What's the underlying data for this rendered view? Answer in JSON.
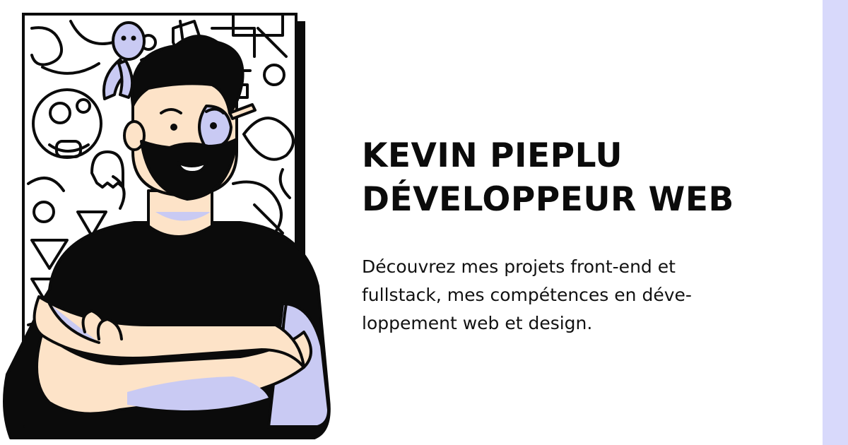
{
  "card": {
    "title_lines": [
      "KEVIN PIEPLU",
      "DÉVELOPPEUR WEB"
    ],
    "description_lines": [
      "Découvrez mes projets front-end et",
      "fullstack, mes compétences en déve-",
      "loppement web et design."
    ]
  },
  "colors": {
    "background": "#ffffff",
    "accent_lavender": "#d8d9fb",
    "ink": "#0b0b0b",
    "skin": "#fde3c8",
    "shadow_lavender": "#c9caf3"
  },
  "illustration": {
    "subject": "bearded-man-crossed-arms-avatar",
    "backdrop": "doodle-pattern-frame"
  }
}
